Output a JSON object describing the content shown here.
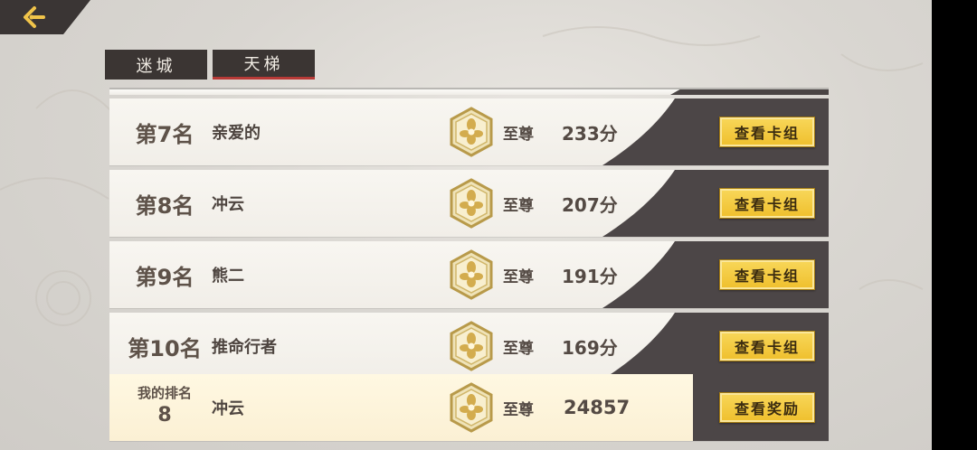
{
  "tabs": [
    {
      "label": "迷城",
      "active": false
    },
    {
      "label": "天梯",
      "active": true
    }
  ],
  "rows": [
    {
      "rank": "第7名",
      "name": "亲爱的",
      "tier": "至尊",
      "score": "233分",
      "button": "查看卡组"
    },
    {
      "rank": "第8名",
      "name": "冲云",
      "tier": "至尊",
      "score": "207分",
      "button": "查看卡组"
    },
    {
      "rank": "第9名",
      "name": "熊二",
      "tier": "至尊",
      "score": "191分",
      "button": "查看卡组"
    },
    {
      "rank": "第10名",
      "name": "推命行者",
      "tier": "至尊",
      "score": "169分",
      "button": "查看卡组"
    }
  ],
  "my_rank": {
    "label": "我的排名",
    "rank": "8",
    "name": "冲云",
    "tier": "至尊",
    "score": "24857",
    "button": "查看奖励"
  },
  "icons": {
    "back": "back-arrow-icon",
    "tier_badge": "supreme-tier-badge-icon"
  },
  "colors": {
    "tab_bg": "#3b3533",
    "tab_active_underline": "#b83a37",
    "button_gold": "#f3c93e",
    "row_dark_panel": "#4c4647",
    "my_row_bg": "#fbf0d4"
  }
}
